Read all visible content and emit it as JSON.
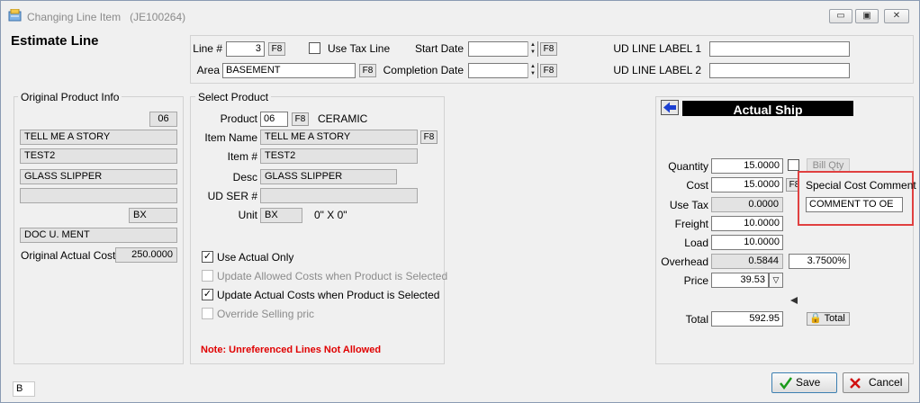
{
  "window": {
    "title": "Changing Line Item",
    "record_id": "(JE100264)",
    "min_glyph": "▭",
    "restore_glyph": "▣",
    "close_glyph": "✕"
  },
  "heading": "Estimate Line",
  "top": {
    "line_label": "Line #",
    "line_value": "3",
    "f8": "F8",
    "use_tax_line_label": "Use Tax Line",
    "start_date_label": "Start Date",
    "start_date_value": "",
    "area_label": "Area",
    "area_value": "BASEMENT",
    "completion_date_label": "Completion Date",
    "completion_date_value": "",
    "ud_line_label_1": "UD LINE LABEL 1",
    "ud_line_value_1": "",
    "ud_line_label_2": "UD LINE LABEL 2",
    "ud_line_value_2": ""
  },
  "original": {
    "section_label": "Original Product Info",
    "product_code": "06",
    "item_name": "TELL ME A STORY",
    "item_number": "TEST2",
    "desc": "GLASS SLIPPER",
    "ud_ser": "",
    "unit": "BX",
    "doc_ment": "DOC U. MENT",
    "actual_cost_label": "Original Actual Cost:",
    "actual_cost_value": "250.0000"
  },
  "select": {
    "section_label": "Select Product",
    "product_label": "Product",
    "product_value": "06",
    "product_name": "CERAMIC",
    "item_name_label": "Item Name",
    "item_name_value": "TELL ME A STORY",
    "item_number_label": "Item #",
    "item_number_value": "TEST2",
    "desc_label": "Desc",
    "desc_value": "GLASS SLIPPER",
    "ud_ser_label": "UD SER #",
    "ud_ser_value": "",
    "unit_label": "Unit",
    "unit_value": "BX",
    "dimensions": "0\" X 0\"",
    "use_actual_only": "Use Actual Only",
    "update_allowed": "Update Allowed Costs when Product is Selected",
    "update_actual": "Update Actual Costs when Product is Selected",
    "override_selling": "Override Selling pric",
    "note": "Note:  Unreferenced Lines Not Allowed"
  },
  "actual": {
    "header": "Actual Ship",
    "quantity_label": "Quantity",
    "quantity_value": "15.0000",
    "bill_qty_label": "Bill Qty",
    "cost_label": "Cost",
    "cost_value": "15.0000",
    "special_cost_label": "Special Cost Comment",
    "special_cost_value": "COMMENT TO OE",
    "use_tax_label": "Use Tax",
    "use_tax_value": "0.0000",
    "freight_label": "Freight",
    "freight_value": "10.0000",
    "load_label": "Load",
    "load_value": "10.0000",
    "overhead_label": "Overhead",
    "overhead_value": "0.5844",
    "overhead_pct": "3.7500%",
    "price_label": "Price",
    "price_value": "39.53",
    "total_label": "Total",
    "total_value": "592.95",
    "total_button": "Total"
  },
  "footer": {
    "status": "B",
    "save": "Save",
    "cancel": "Cancel"
  },
  "colors": {
    "note_red": "#e00000",
    "highlight_red": "#e04040",
    "header_black": "#000000",
    "arrow_blue": "#1b3fd1"
  }
}
